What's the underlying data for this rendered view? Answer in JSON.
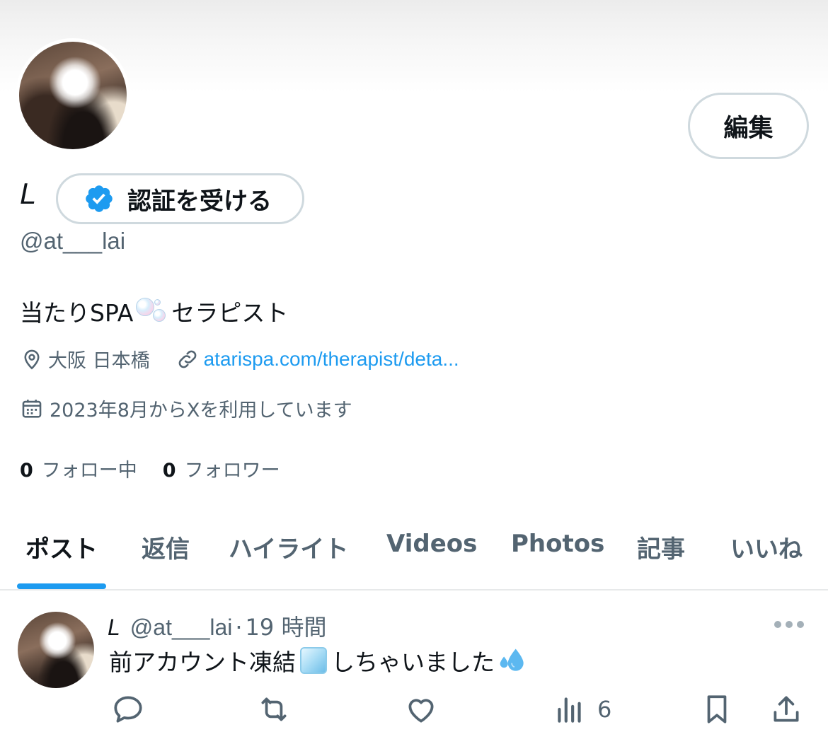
{
  "profile": {
    "edit_label": "編集",
    "name": "L",
    "verify_label": "認証を受ける",
    "handle": "@at___lai",
    "bio_pre": "当たりSPA",
    "bio_post": "セラピスト",
    "location": "大阪 日本橋",
    "website": "atarispa.com/therapist/deta...",
    "joined": "2023年8月からXを利用しています",
    "following_count": "0",
    "following_label": "フォロー中",
    "followers_count": "0",
    "followers_label": "フォロワー"
  },
  "tabs": [
    {
      "label": "ポスト",
      "active": true
    },
    {
      "label": "返信"
    },
    {
      "label": "ハイライト"
    },
    {
      "label": "Videos"
    },
    {
      "label": "Photos"
    },
    {
      "label": "記事"
    },
    {
      "label": "いいね"
    }
  ],
  "post": {
    "name": "L",
    "handle": "@at___lai",
    "separator": "·",
    "time": "19 時間",
    "text_pre": "前アカウント凍結",
    "text_post": "しちゃいました",
    "views": "6"
  },
  "colors": {
    "accent": "#1d9bf0",
    "text_primary": "#0f1419",
    "text_secondary": "#536471",
    "border": "#cfd9de"
  },
  "icons": [
    "location-icon",
    "link-icon",
    "calendar-icon",
    "verified-badge-icon",
    "reply-icon",
    "repost-icon",
    "like-icon",
    "views-icon",
    "bookmark-icon",
    "share-icon",
    "more-icon"
  ]
}
